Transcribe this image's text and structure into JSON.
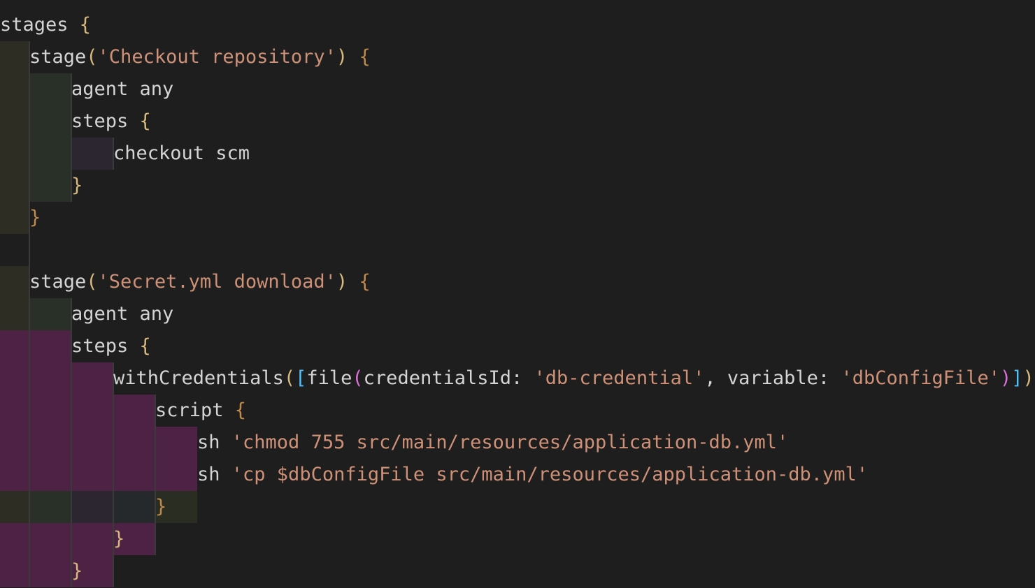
{
  "editor": {
    "language": "groovy",
    "colors": {
      "background": "#1e1e1e",
      "text": "#d4d4d4",
      "string": "#ce9178",
      "bracket_gold": "#d7ba7d",
      "bracket_orange": "#c08a4a",
      "bracket_magenta": "#da70d6",
      "bracket_blue": "#4fc1ff",
      "indent_level_1": "#2d2d24",
      "indent_level_2": "#283028",
      "indent_level_3": "#2c2630",
      "indent_level_4": "#26292c",
      "indent_level_5": "#2a2e22",
      "indent_error": "#4d2245"
    },
    "lines": [
      {
        "indent": 0,
        "bands": [],
        "tokens": [
          {
            "t": "stages ",
            "c": "plain"
          },
          {
            "t": "{",
            "c": "b1"
          }
        ]
      },
      {
        "indent": 1,
        "bands": [
          "indent_level_1"
        ],
        "tokens": [
          {
            "t": "stage",
            "c": "plain"
          },
          {
            "t": "(",
            "c": "b1"
          },
          {
            "t": "'Checkout repository'",
            "c": "str"
          },
          {
            "t": ")",
            "c": "b1"
          },
          {
            "t": " ",
            "c": "plain"
          },
          {
            "t": "{",
            "c": "bo"
          }
        ]
      },
      {
        "indent": 2,
        "bands": [
          "indent_level_1",
          "indent_level_2"
        ],
        "tokens": [
          {
            "t": "agent any",
            "c": "plain"
          }
        ]
      },
      {
        "indent": 2,
        "bands": [
          "indent_level_1",
          "indent_level_2"
        ],
        "tokens": [
          {
            "t": "steps ",
            "c": "plain"
          },
          {
            "t": "{",
            "c": "b1"
          }
        ]
      },
      {
        "indent": 3,
        "bands": [
          "indent_level_1",
          "indent_level_2",
          "indent_level_3"
        ],
        "tokens": [
          {
            "t": "checkout scm",
            "c": "plain"
          }
        ]
      },
      {
        "indent": 2,
        "bands": [
          "indent_level_1",
          "indent_level_2"
        ],
        "tokens": [
          {
            "t": "}",
            "c": "b1"
          }
        ]
      },
      {
        "indent": 1,
        "bands": [
          "indent_level_1"
        ],
        "tokens": [
          {
            "t": "}",
            "c": "bo"
          }
        ]
      },
      {
        "indent": 0,
        "bands": [],
        "tokens": []
      },
      {
        "indent": 1,
        "bands": [
          "indent_level_1"
        ],
        "tokens": [
          {
            "t": "stage",
            "c": "plain"
          },
          {
            "t": "(",
            "c": "b1"
          },
          {
            "t": "'Secret.yml download'",
            "c": "str"
          },
          {
            "t": ")",
            "c": "b1"
          },
          {
            "t": " ",
            "c": "plain"
          },
          {
            "t": "{",
            "c": "bo"
          }
        ]
      },
      {
        "indent": 2,
        "bands": [
          "indent_level_1",
          "indent_level_2"
        ],
        "tokens": [
          {
            "t": "agent any",
            "c": "plain"
          }
        ]
      },
      {
        "indent": 2,
        "bands": [
          "indent_error",
          "indent_error"
        ],
        "tokens": [
          {
            "t": "steps ",
            "c": "plain"
          },
          {
            "t": "{",
            "c": "b1"
          }
        ]
      },
      {
        "indent": 3,
        "bands": [
          "indent_error",
          "indent_error",
          "indent_error"
        ],
        "tokens": [
          {
            "t": "withCredentials",
            "c": "plain"
          },
          {
            "t": "(",
            "c": "b1"
          },
          {
            "t": "[",
            "c": "b3"
          },
          {
            "t": "file",
            "c": "plain"
          },
          {
            "t": "(",
            "c": "b2"
          },
          {
            "t": "credentialsId: ",
            "c": "plain"
          },
          {
            "t": "'db-credential'",
            "c": "str"
          },
          {
            "t": ", variable: ",
            "c": "plain"
          },
          {
            "t": "'dbConfigFile'",
            "c": "str"
          },
          {
            "t": ")",
            "c": "b2"
          },
          {
            "t": "]",
            "c": "b3"
          },
          {
            "t": ")",
            "c": "b1"
          },
          {
            "t": " ",
            "c": "plain"
          },
          {
            "t": "{",
            "c": "b1"
          }
        ]
      },
      {
        "indent": 4,
        "bands": [
          "indent_error",
          "indent_error",
          "indent_error",
          "indent_error"
        ],
        "tokens": [
          {
            "t": "script ",
            "c": "plain"
          },
          {
            "t": "{",
            "c": "bo"
          }
        ]
      },
      {
        "indent": 5,
        "bands": [
          "indent_error",
          "indent_error",
          "indent_error",
          "indent_error",
          "indent_error"
        ],
        "tokens": [
          {
            "t": "sh ",
            "c": "plain"
          },
          {
            "t": "'chmod 755 src/main/resources/application-db.yml'",
            "c": "str"
          }
        ]
      },
      {
        "indent": 5,
        "bands": [
          "indent_error",
          "indent_error",
          "indent_error",
          "indent_error",
          "indent_error"
        ],
        "tokens": [
          {
            "t": "sh ",
            "c": "plain"
          },
          {
            "t": "'cp $dbConfigFile src/main/resources/application-db.yml'",
            "c": "str"
          }
        ]
      },
      {
        "indent": 4,
        "bands": [
          "indent_level_1",
          "indent_level_2",
          "indent_level_3",
          "indent_level_4",
          "indent_level_5"
        ],
        "tokens": [
          {
            "t": "}",
            "c": "bo"
          }
        ]
      },
      {
        "indent": 3,
        "bands": [
          "indent_error",
          "indent_error",
          "indent_error",
          "indent_error"
        ],
        "tokens": [
          {
            "t": "}",
            "c": "b1"
          }
        ]
      },
      {
        "indent": 2,
        "bands": [
          "indent_error",
          "indent_error",
          "indent_error"
        ],
        "tokens": [
          {
            "t": "}",
            "c": "b1"
          }
        ]
      }
    ]
  }
}
